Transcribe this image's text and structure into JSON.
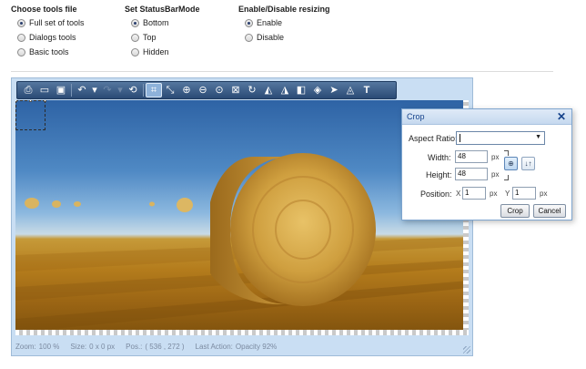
{
  "tools_file": {
    "title": "Choose tools file",
    "options": [
      {
        "label": "Full set of tools",
        "checked": true
      },
      {
        "label": "Dialogs tools",
        "checked": false
      },
      {
        "label": "Basic tools",
        "checked": false
      }
    ]
  },
  "statusbar_mode": {
    "title": "Set StatusBarMode",
    "options": [
      {
        "label": "Bottom",
        "checked": true
      },
      {
        "label": "Top",
        "checked": false
      },
      {
        "label": "Hidden",
        "checked": false
      }
    ]
  },
  "resizing": {
    "title": "Enable/Disable resizing",
    "options": [
      {
        "label": "Enable",
        "checked": true
      },
      {
        "label": "Disable",
        "checked": false
      }
    ]
  },
  "toolbar": {
    "tools": [
      {
        "icon": "print-icon",
        "glyph": "⎙"
      },
      {
        "icon": "open-icon",
        "glyph": "▭"
      },
      {
        "icon": "save-icon",
        "glyph": "▣"
      },
      {
        "icon": "undo-icon",
        "glyph": "↶"
      },
      {
        "icon": "undo-dropdown-icon",
        "glyph": "▾"
      },
      {
        "icon": "redo-icon",
        "glyph": "↷"
      },
      {
        "icon": "redo-dropdown-icon",
        "glyph": "▾"
      },
      {
        "icon": "reset-icon",
        "glyph": "⟲"
      },
      {
        "icon": "crop-icon",
        "glyph": "⌗"
      },
      {
        "icon": "resize-icon",
        "glyph": "⤡"
      },
      {
        "icon": "zoom-in-icon",
        "glyph": "⊕"
      },
      {
        "icon": "zoom-out-icon",
        "glyph": "⊖"
      },
      {
        "icon": "zoom-fit-icon",
        "glyph": "⊙"
      },
      {
        "icon": "canvas-resize-icon",
        "glyph": "⊠"
      },
      {
        "icon": "rotate-icon",
        "glyph": "↻"
      },
      {
        "icon": "flip-horizontal-icon",
        "glyph": "◭"
      },
      {
        "icon": "flip-vertical-icon",
        "glyph": "◮"
      },
      {
        "icon": "adjust-icon",
        "glyph": "◧"
      },
      {
        "icon": "sharpen-icon",
        "glyph": "◈"
      },
      {
        "icon": "draw-icon",
        "glyph": "➤"
      },
      {
        "icon": "shape-icon",
        "glyph": "◬"
      },
      {
        "icon": "text-icon",
        "glyph": "T"
      }
    ]
  },
  "status": {
    "zoom_label": "Zoom:",
    "zoom_value": "100 %",
    "size_label": "Size:",
    "size_value": "0 x 0 px",
    "pos_label": "Pos.:",
    "pos_value": "( 536 , 272 )",
    "action_label": "Last Action:",
    "action_value": "Opacity 92%"
  },
  "crop": {
    "title": "Crop",
    "close": "✕",
    "aspect_label": "Aspect Ratio:",
    "aspect_value": "",
    "width_label": "Width:",
    "width_value": "48",
    "height_label": "Height:",
    "height_value": "48",
    "unit": "px",
    "position_label": "Position:",
    "x_label": "X",
    "x_value": "1",
    "y_label": "Y",
    "y_value": "1",
    "lock_glyph": "⊕",
    "swap_glyph": "↓↑",
    "crop_button": "Crop",
    "cancel_button": "Cancel"
  }
}
